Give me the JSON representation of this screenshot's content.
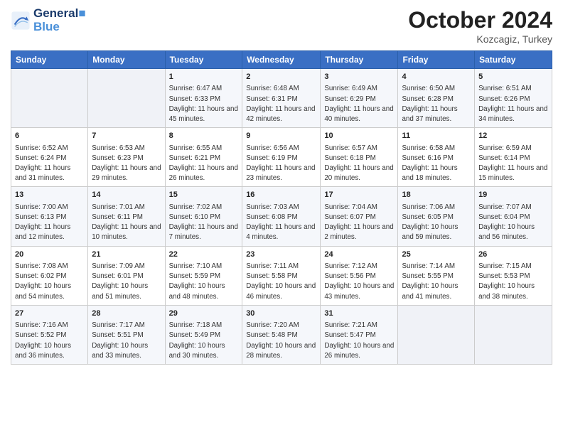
{
  "header": {
    "logo_line1": "General",
    "logo_line2": "Blue",
    "month": "October 2024",
    "location": "Kozcagiz, Turkey"
  },
  "columns": [
    "Sunday",
    "Monday",
    "Tuesday",
    "Wednesday",
    "Thursday",
    "Friday",
    "Saturday"
  ],
  "rows": [
    [
      {
        "day": "",
        "content": ""
      },
      {
        "day": "",
        "content": ""
      },
      {
        "day": "1",
        "content": "Sunrise: 6:47 AM\nSunset: 6:33 PM\nDaylight: 11 hours and 45 minutes."
      },
      {
        "day": "2",
        "content": "Sunrise: 6:48 AM\nSunset: 6:31 PM\nDaylight: 11 hours and 42 minutes."
      },
      {
        "day": "3",
        "content": "Sunrise: 6:49 AM\nSunset: 6:29 PM\nDaylight: 11 hours and 40 minutes."
      },
      {
        "day": "4",
        "content": "Sunrise: 6:50 AM\nSunset: 6:28 PM\nDaylight: 11 hours and 37 minutes."
      },
      {
        "day": "5",
        "content": "Sunrise: 6:51 AM\nSunset: 6:26 PM\nDaylight: 11 hours and 34 minutes."
      }
    ],
    [
      {
        "day": "6",
        "content": "Sunrise: 6:52 AM\nSunset: 6:24 PM\nDaylight: 11 hours and 31 minutes."
      },
      {
        "day": "7",
        "content": "Sunrise: 6:53 AM\nSunset: 6:23 PM\nDaylight: 11 hours and 29 minutes."
      },
      {
        "day": "8",
        "content": "Sunrise: 6:55 AM\nSunset: 6:21 PM\nDaylight: 11 hours and 26 minutes."
      },
      {
        "day": "9",
        "content": "Sunrise: 6:56 AM\nSunset: 6:19 PM\nDaylight: 11 hours and 23 minutes."
      },
      {
        "day": "10",
        "content": "Sunrise: 6:57 AM\nSunset: 6:18 PM\nDaylight: 11 hours and 20 minutes."
      },
      {
        "day": "11",
        "content": "Sunrise: 6:58 AM\nSunset: 6:16 PM\nDaylight: 11 hours and 18 minutes."
      },
      {
        "day": "12",
        "content": "Sunrise: 6:59 AM\nSunset: 6:14 PM\nDaylight: 11 hours and 15 minutes."
      }
    ],
    [
      {
        "day": "13",
        "content": "Sunrise: 7:00 AM\nSunset: 6:13 PM\nDaylight: 11 hours and 12 minutes."
      },
      {
        "day": "14",
        "content": "Sunrise: 7:01 AM\nSunset: 6:11 PM\nDaylight: 11 hours and 10 minutes."
      },
      {
        "day": "15",
        "content": "Sunrise: 7:02 AM\nSunset: 6:10 PM\nDaylight: 11 hours and 7 minutes."
      },
      {
        "day": "16",
        "content": "Sunrise: 7:03 AM\nSunset: 6:08 PM\nDaylight: 11 hours and 4 minutes."
      },
      {
        "day": "17",
        "content": "Sunrise: 7:04 AM\nSunset: 6:07 PM\nDaylight: 11 hours and 2 minutes."
      },
      {
        "day": "18",
        "content": "Sunrise: 7:06 AM\nSunset: 6:05 PM\nDaylight: 10 hours and 59 minutes."
      },
      {
        "day": "19",
        "content": "Sunrise: 7:07 AM\nSunset: 6:04 PM\nDaylight: 10 hours and 56 minutes."
      }
    ],
    [
      {
        "day": "20",
        "content": "Sunrise: 7:08 AM\nSunset: 6:02 PM\nDaylight: 10 hours and 54 minutes."
      },
      {
        "day": "21",
        "content": "Sunrise: 7:09 AM\nSunset: 6:01 PM\nDaylight: 10 hours and 51 minutes."
      },
      {
        "day": "22",
        "content": "Sunrise: 7:10 AM\nSunset: 5:59 PM\nDaylight: 10 hours and 48 minutes."
      },
      {
        "day": "23",
        "content": "Sunrise: 7:11 AM\nSunset: 5:58 PM\nDaylight: 10 hours and 46 minutes."
      },
      {
        "day": "24",
        "content": "Sunrise: 7:12 AM\nSunset: 5:56 PM\nDaylight: 10 hours and 43 minutes."
      },
      {
        "day": "25",
        "content": "Sunrise: 7:14 AM\nSunset: 5:55 PM\nDaylight: 10 hours and 41 minutes."
      },
      {
        "day": "26",
        "content": "Sunrise: 7:15 AM\nSunset: 5:53 PM\nDaylight: 10 hours and 38 minutes."
      }
    ],
    [
      {
        "day": "27",
        "content": "Sunrise: 7:16 AM\nSunset: 5:52 PM\nDaylight: 10 hours and 36 minutes."
      },
      {
        "day": "28",
        "content": "Sunrise: 7:17 AM\nSunset: 5:51 PM\nDaylight: 10 hours and 33 minutes."
      },
      {
        "day": "29",
        "content": "Sunrise: 7:18 AM\nSunset: 5:49 PM\nDaylight: 10 hours and 30 minutes."
      },
      {
        "day": "30",
        "content": "Sunrise: 7:20 AM\nSunset: 5:48 PM\nDaylight: 10 hours and 28 minutes."
      },
      {
        "day": "31",
        "content": "Sunrise: 7:21 AM\nSunset: 5:47 PM\nDaylight: 10 hours and 26 minutes."
      },
      {
        "day": "",
        "content": ""
      },
      {
        "day": "",
        "content": ""
      }
    ]
  ]
}
